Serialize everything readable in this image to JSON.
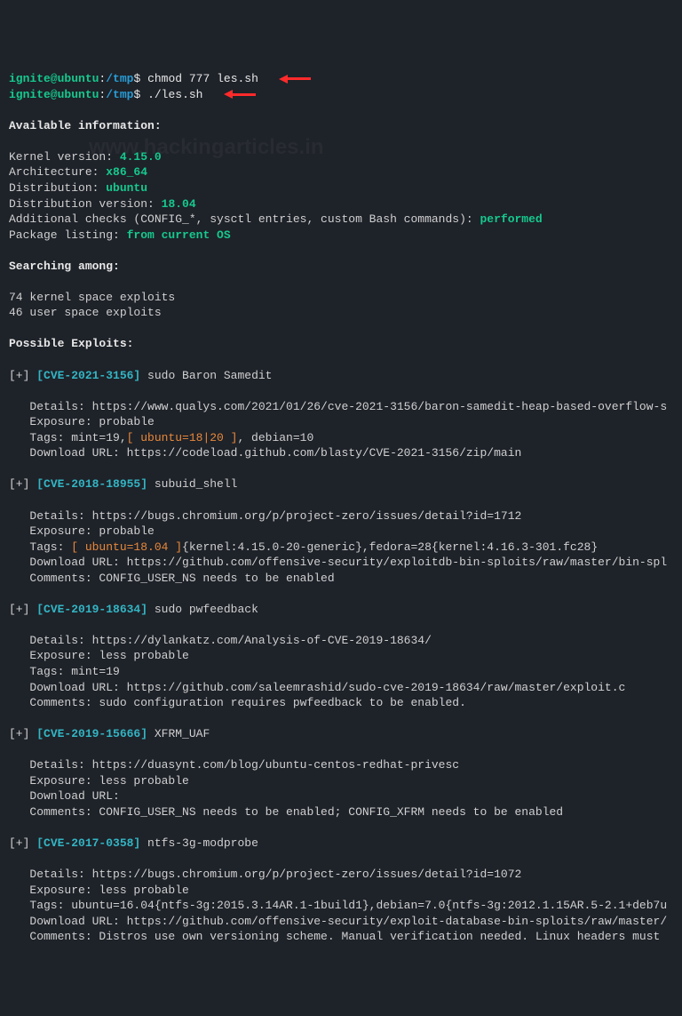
{
  "prompt": {
    "user": "ignite@ubuntu",
    "sep": ":",
    "path": "/tmp",
    "dollar": "$"
  },
  "cmd1": "chmod 777 les.sh",
  "cmd2": "./les.sh",
  "watermark": "www.hackingarticles.in",
  "section_available": "Available information:",
  "info": {
    "kernel_label": "Kernel version: ",
    "kernel_value": "4.15.0",
    "arch_label": "Architecture: ",
    "arch_value": "x86_64",
    "dist_label": "Distribution: ",
    "dist_value": "ubuntu",
    "distver_label": "Distribution version: ",
    "distver_value": "18.04",
    "checks_label": "Additional checks (CONFIG_*, sysctl entries, custom Bash commands): ",
    "checks_value": "performed",
    "pkg_label": "Package listing: ",
    "pkg_value": "from current OS"
  },
  "section_searching": "Searching among:",
  "searching": {
    "kernel": "74 kernel space exploits",
    "user": "46 user space exploits"
  },
  "section_exploits": "Possible Exploits:",
  "ex1": {
    "prefix": "[+] ",
    "cve": "[CVE-2021-3156]",
    "name": " sudo Baron Samedit",
    "details": "   Details: https://www.qualys.com/2021/01/26/cve-2021-3156/baron-samedit-heap-based-overflow-s",
    "exposure": "   Exposure: probable",
    "tags_pre": "   Tags: mint=19,",
    "tags_hl": "[ ubuntu=18|20 ]",
    "tags_post": ", debian=10",
    "download": "   Download URL: https://codeload.github.com/blasty/CVE-2021-3156/zip/main"
  },
  "ex2": {
    "prefix": "[+] ",
    "cve": "[CVE-2018-18955]",
    "name": " subuid_shell",
    "details": "   Details: https://bugs.chromium.org/p/project-zero/issues/detail?id=1712",
    "exposure": "   Exposure: probable",
    "tags_pre": "   Tags: ",
    "tags_hl": "[ ubuntu=18.04 ]",
    "tags_post": "{kernel:4.15.0-20-generic},fedora=28{kernel:4.16.3-301.fc28}",
    "download": "   Download URL: https://github.com/offensive-security/exploitdb-bin-sploits/raw/master/bin-spl",
    "comments": "   Comments: CONFIG_USER_NS needs to be enabled"
  },
  "ex3": {
    "prefix": "[+] ",
    "cve": "[CVE-2019-18634]",
    "name": " sudo pwfeedback",
    "details": "   Details: https://dylankatz.com/Analysis-of-CVE-2019-18634/",
    "exposure": "   Exposure: less probable",
    "tags": "   Tags: mint=19",
    "download": "   Download URL: https://github.com/saleemrashid/sudo-cve-2019-18634/raw/master/exploit.c",
    "comments": "   Comments: sudo configuration requires pwfeedback to be enabled."
  },
  "ex4": {
    "prefix": "[+] ",
    "cve": "[CVE-2019-15666]",
    "name": " XFRM_UAF",
    "details": "   Details: https://duasynt.com/blog/ubuntu-centos-redhat-privesc",
    "exposure": "   Exposure: less probable",
    "download": "   Download URL:",
    "comments": "   Comments: CONFIG_USER_NS needs to be enabled; CONFIG_XFRM needs to be enabled"
  },
  "ex5": {
    "prefix": "[+] ",
    "cve": "[CVE-2017-0358]",
    "name": " ntfs-3g-modprobe",
    "details": "   Details: https://bugs.chromium.org/p/project-zero/issues/detail?id=1072",
    "exposure": "   Exposure: less probable",
    "tags": "   Tags: ubuntu=16.04{ntfs-3g:2015.3.14AR.1-1build1},debian=7.0{ntfs-3g:2012.1.15AR.5-2.1+deb7u",
    "download": "   Download URL: https://github.com/offensive-security/exploit-database-bin-sploits/raw/master/",
    "comments": "   Comments: Distros use own versioning scheme. Manual verification needed. Linux headers must "
  }
}
